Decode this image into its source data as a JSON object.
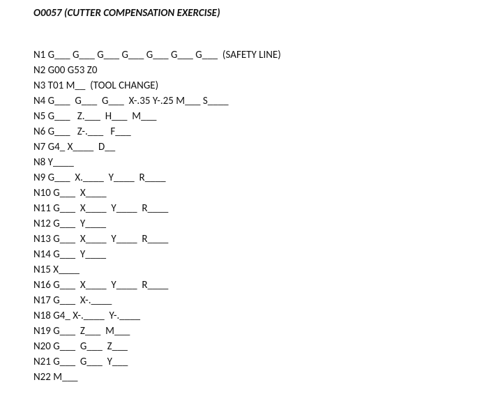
{
  "title": "O0057 (CUTTER COMPENSATION EXERCISE)",
  "lines": [
    "N1 G___ G___ G___ G___ G___ G___ G___  (SAFETY LINE)",
    "N2 G00 G53 Z0",
    "N3 T01 M__  (TOOL CHANGE)",
    "N4 G___  G___  G___  X-.35 Y-.25 M___ S____",
    "N5 G___   Z.___  H___  M___",
    "N6 G___   Z-.___   F___",
    "N7 G4_ X____  D__",
    "N8 Y____",
    "N9 G___  X.____  Y____  R____",
    "N10 G___  X____",
    "N11 G___  X____  Y____  R____",
    "N12 G___  Y____",
    "N13 G___  X____  Y____  R____",
    "N14 G___  Y____",
    "N15 X____",
    "N16 G___  X____  Y____  R____",
    "N17 G___  X-.____",
    "N18 G4_ X-.____  Y-.____",
    "N19 G___  Z___  M___",
    "N20 G___  G___  Z___",
    "N21 G___  G___  Y___",
    "N22 M___"
  ]
}
